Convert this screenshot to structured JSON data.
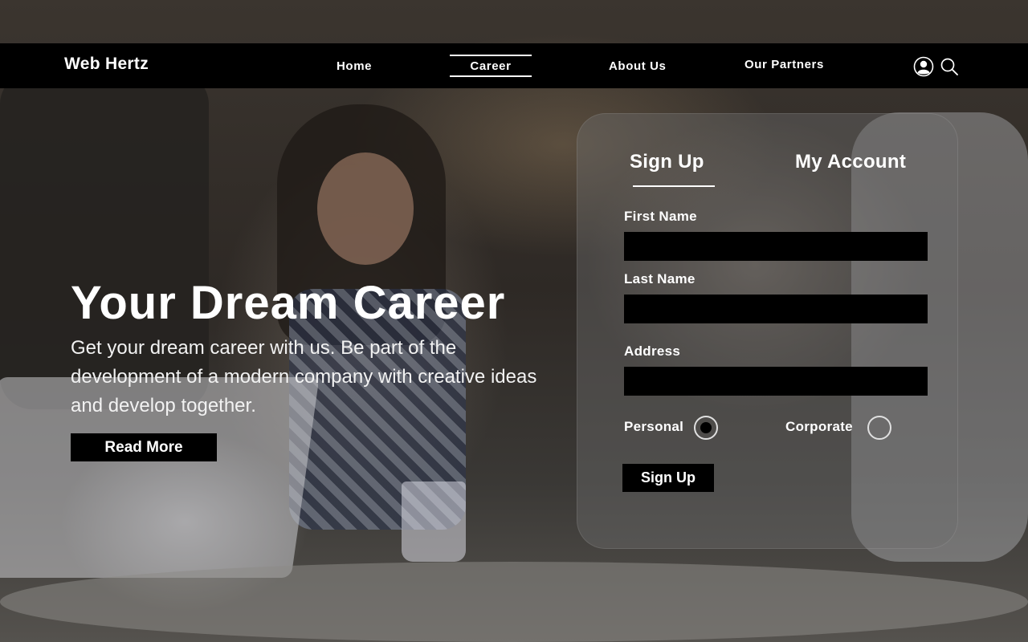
{
  "nav": {
    "brand": "Web Hertz",
    "links": [
      "Home",
      "Career",
      "About Us",
      "Our Partners"
    ],
    "active": "Career",
    "icons": [
      "user-icon",
      "search-icon"
    ]
  },
  "hero": {
    "title": "Your Dream Career",
    "text": "Get your dream career with us. Be part of the development of a modern company with creative ideas and develop together.",
    "button": "Read More"
  },
  "form": {
    "tabs": [
      "Sign Up",
      "My Account"
    ],
    "active_tab": "Sign Up",
    "fields": [
      {
        "label": "First Name",
        "value": ""
      },
      {
        "label": "Last Name",
        "value": ""
      },
      {
        "label": "Address",
        "value": ""
      }
    ],
    "account_types": [
      "Personal",
      "Corporate"
    ],
    "selected_type": "Personal",
    "submit": "Sign Up"
  },
  "colors": {
    "nav_bg": "#000000",
    "text": "#ffffff",
    "input_bg": "#000000",
    "card_bg": "rgba(110,110,110,0.42)"
  }
}
